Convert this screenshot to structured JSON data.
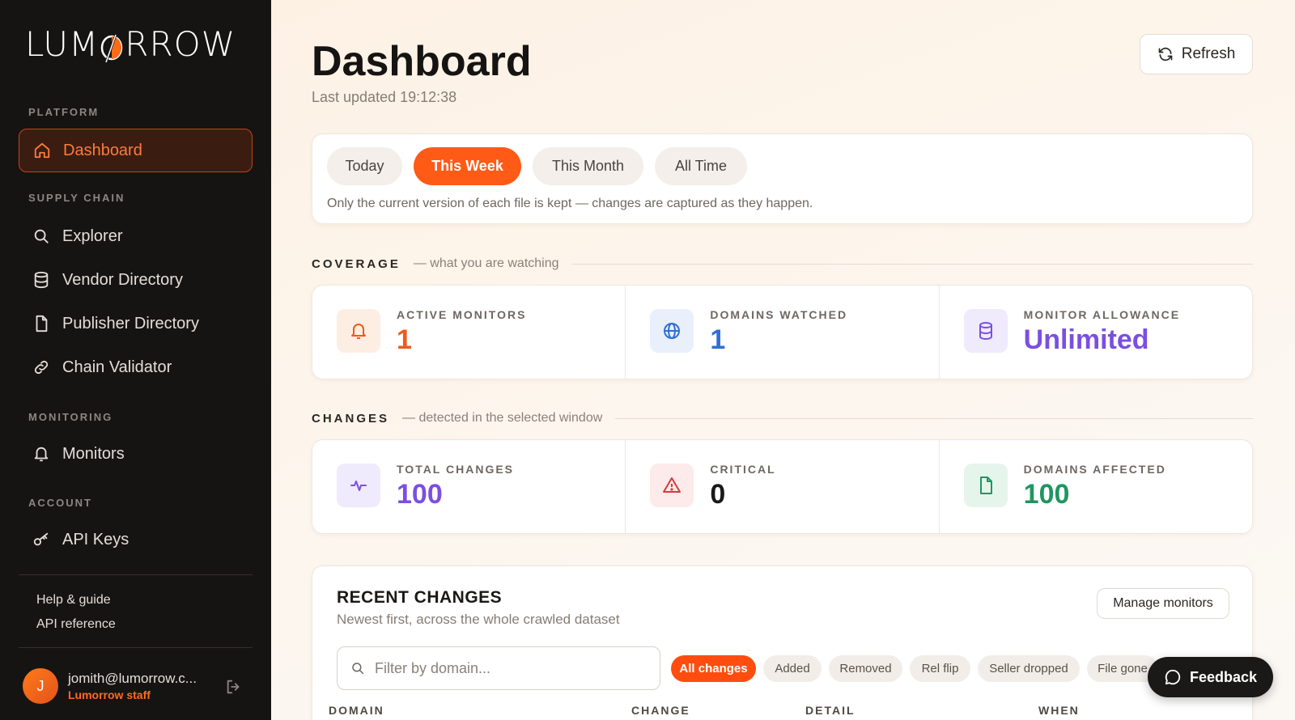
{
  "brand": {
    "name_left": "LUM",
    "name_right": "RROW",
    "accent": "#ff5a16"
  },
  "sidebar": {
    "sections": {
      "platform": "PLATFORM",
      "supply_chain": "SUPPLY CHAIN",
      "monitoring": "MONITORING",
      "account": "ACCOUNT"
    },
    "items": {
      "dashboard": "Dashboard",
      "explorer": "Explorer",
      "vendor_directory": "Vendor Directory",
      "publisher_directory": "Publisher Directory",
      "chain_validator": "Chain Validator",
      "monitors": "Monitors",
      "api_keys": "API Keys"
    },
    "links": {
      "help": "Help & guide",
      "api_reference": "API reference"
    },
    "user": {
      "initial": "J",
      "email": "jomith@lumorrow.c...",
      "role": "Lumorrow staff"
    }
  },
  "header": {
    "title": "Dashboard",
    "last_updated": "Last updated 19:12:38",
    "refresh_label": "Refresh"
  },
  "range": {
    "options": {
      "today": "Today",
      "this_week": "This Week",
      "this_month": "This Month",
      "all_time": "All Time"
    },
    "selected": "This Week",
    "note": "Only the current version of each file is kept — changes are captured as they happen."
  },
  "coverage": {
    "title": "COVERAGE",
    "subtitle": "— what you are watching",
    "stats": {
      "active_monitors": {
        "label": "ACTIVE MONITORS",
        "value": "1",
        "color": "#ef5a1d"
      },
      "domains_watched": {
        "label": "DOMAINS WATCHED",
        "value": "1",
        "color": "#2f6fd6"
      },
      "monitor_allowance": {
        "label": "MONITOR ALLOWANCE",
        "value": "Unlimited",
        "color": "#7b4fe0"
      }
    }
  },
  "changes": {
    "title": "CHANGES",
    "subtitle": "— detected in the selected window",
    "stats": {
      "total_changes": {
        "label": "TOTAL CHANGES",
        "value": "100",
        "color": "#7b4fe0"
      },
      "critical": {
        "label": "CRITICAL",
        "value": "0",
        "color": "#1b1917"
      },
      "domains_affected": {
        "label": "DOMAINS AFFECTED",
        "value": "100",
        "color": "#1f9660"
      }
    }
  },
  "recent": {
    "title": "RECENT CHANGES",
    "subtitle": "Newest first, across the whole crawled dataset",
    "manage_label": "Manage monitors",
    "filter_placeholder": "Filter by domain...",
    "chips": {
      "all": "All changes",
      "added": "Added",
      "removed": "Removed",
      "rel_flip": "Rel flip",
      "seller_dropped": "Seller dropped",
      "file_gone": "File gone"
    },
    "columns": {
      "domain": "DOMAIN",
      "change": "CHANGE",
      "detail": "DETAIL",
      "when": "WHEN"
    }
  },
  "feedback_label": "Feedback"
}
